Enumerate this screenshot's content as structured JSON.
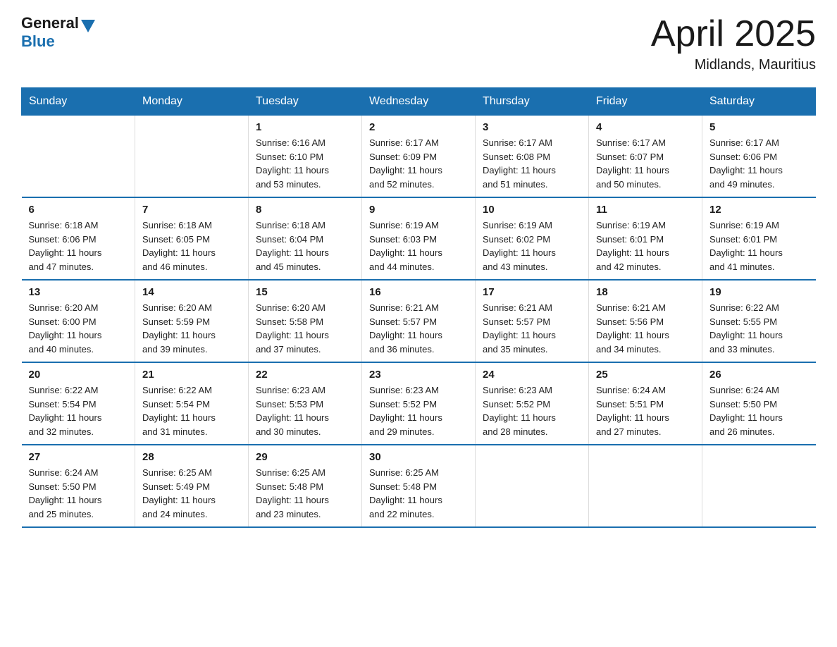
{
  "logo": {
    "general": "General",
    "blue": "Blue"
  },
  "title": "April 2025",
  "subtitle": "Midlands, Mauritius",
  "days_of_week": [
    "Sunday",
    "Monday",
    "Tuesday",
    "Wednesday",
    "Thursday",
    "Friday",
    "Saturday"
  ],
  "weeks": [
    [
      {
        "day": "",
        "info": ""
      },
      {
        "day": "",
        "info": ""
      },
      {
        "day": "1",
        "info": "Sunrise: 6:16 AM\nSunset: 6:10 PM\nDaylight: 11 hours\nand 53 minutes."
      },
      {
        "day": "2",
        "info": "Sunrise: 6:17 AM\nSunset: 6:09 PM\nDaylight: 11 hours\nand 52 minutes."
      },
      {
        "day": "3",
        "info": "Sunrise: 6:17 AM\nSunset: 6:08 PM\nDaylight: 11 hours\nand 51 minutes."
      },
      {
        "day": "4",
        "info": "Sunrise: 6:17 AM\nSunset: 6:07 PM\nDaylight: 11 hours\nand 50 minutes."
      },
      {
        "day": "5",
        "info": "Sunrise: 6:17 AM\nSunset: 6:06 PM\nDaylight: 11 hours\nand 49 minutes."
      }
    ],
    [
      {
        "day": "6",
        "info": "Sunrise: 6:18 AM\nSunset: 6:06 PM\nDaylight: 11 hours\nand 47 minutes."
      },
      {
        "day": "7",
        "info": "Sunrise: 6:18 AM\nSunset: 6:05 PM\nDaylight: 11 hours\nand 46 minutes."
      },
      {
        "day": "8",
        "info": "Sunrise: 6:18 AM\nSunset: 6:04 PM\nDaylight: 11 hours\nand 45 minutes."
      },
      {
        "day": "9",
        "info": "Sunrise: 6:19 AM\nSunset: 6:03 PM\nDaylight: 11 hours\nand 44 minutes."
      },
      {
        "day": "10",
        "info": "Sunrise: 6:19 AM\nSunset: 6:02 PM\nDaylight: 11 hours\nand 43 minutes."
      },
      {
        "day": "11",
        "info": "Sunrise: 6:19 AM\nSunset: 6:01 PM\nDaylight: 11 hours\nand 42 minutes."
      },
      {
        "day": "12",
        "info": "Sunrise: 6:19 AM\nSunset: 6:01 PM\nDaylight: 11 hours\nand 41 minutes."
      }
    ],
    [
      {
        "day": "13",
        "info": "Sunrise: 6:20 AM\nSunset: 6:00 PM\nDaylight: 11 hours\nand 40 minutes."
      },
      {
        "day": "14",
        "info": "Sunrise: 6:20 AM\nSunset: 5:59 PM\nDaylight: 11 hours\nand 39 minutes."
      },
      {
        "day": "15",
        "info": "Sunrise: 6:20 AM\nSunset: 5:58 PM\nDaylight: 11 hours\nand 37 minutes."
      },
      {
        "day": "16",
        "info": "Sunrise: 6:21 AM\nSunset: 5:57 PM\nDaylight: 11 hours\nand 36 minutes."
      },
      {
        "day": "17",
        "info": "Sunrise: 6:21 AM\nSunset: 5:57 PM\nDaylight: 11 hours\nand 35 minutes."
      },
      {
        "day": "18",
        "info": "Sunrise: 6:21 AM\nSunset: 5:56 PM\nDaylight: 11 hours\nand 34 minutes."
      },
      {
        "day": "19",
        "info": "Sunrise: 6:22 AM\nSunset: 5:55 PM\nDaylight: 11 hours\nand 33 minutes."
      }
    ],
    [
      {
        "day": "20",
        "info": "Sunrise: 6:22 AM\nSunset: 5:54 PM\nDaylight: 11 hours\nand 32 minutes."
      },
      {
        "day": "21",
        "info": "Sunrise: 6:22 AM\nSunset: 5:54 PM\nDaylight: 11 hours\nand 31 minutes."
      },
      {
        "day": "22",
        "info": "Sunrise: 6:23 AM\nSunset: 5:53 PM\nDaylight: 11 hours\nand 30 minutes."
      },
      {
        "day": "23",
        "info": "Sunrise: 6:23 AM\nSunset: 5:52 PM\nDaylight: 11 hours\nand 29 minutes."
      },
      {
        "day": "24",
        "info": "Sunrise: 6:23 AM\nSunset: 5:52 PM\nDaylight: 11 hours\nand 28 minutes."
      },
      {
        "day": "25",
        "info": "Sunrise: 6:24 AM\nSunset: 5:51 PM\nDaylight: 11 hours\nand 27 minutes."
      },
      {
        "day": "26",
        "info": "Sunrise: 6:24 AM\nSunset: 5:50 PM\nDaylight: 11 hours\nand 26 minutes."
      }
    ],
    [
      {
        "day": "27",
        "info": "Sunrise: 6:24 AM\nSunset: 5:50 PM\nDaylight: 11 hours\nand 25 minutes."
      },
      {
        "day": "28",
        "info": "Sunrise: 6:25 AM\nSunset: 5:49 PM\nDaylight: 11 hours\nand 24 minutes."
      },
      {
        "day": "29",
        "info": "Sunrise: 6:25 AM\nSunset: 5:48 PM\nDaylight: 11 hours\nand 23 minutes."
      },
      {
        "day": "30",
        "info": "Sunrise: 6:25 AM\nSunset: 5:48 PM\nDaylight: 11 hours\nand 22 minutes."
      },
      {
        "day": "",
        "info": ""
      },
      {
        "day": "",
        "info": ""
      },
      {
        "day": "",
        "info": ""
      }
    ]
  ]
}
